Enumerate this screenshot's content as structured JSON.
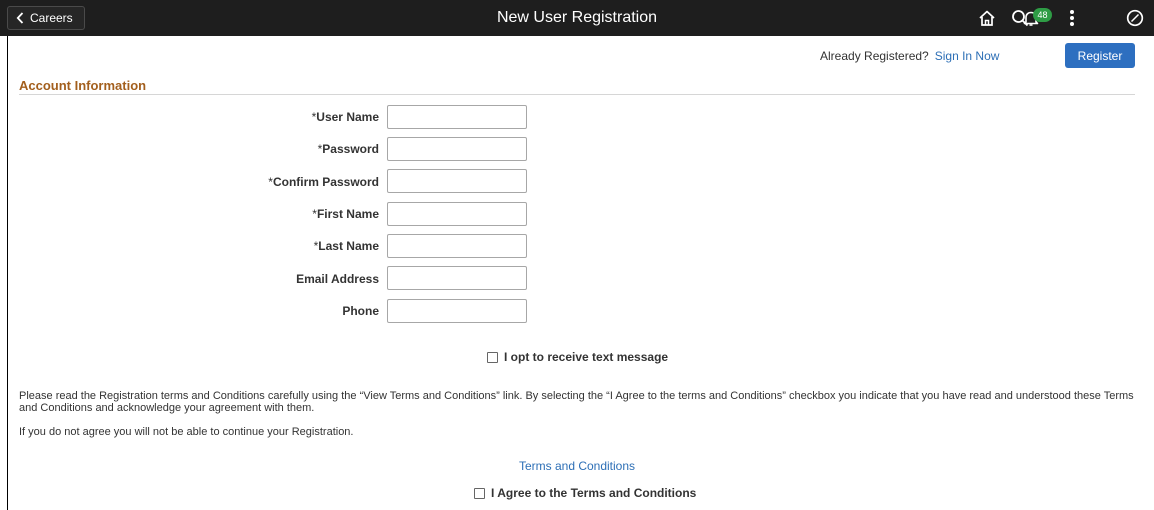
{
  "header": {
    "back_label": "Careers",
    "title": "New User Registration",
    "notification_count": "48",
    "icons": [
      "home-icon",
      "search-icon",
      "notification-bell-icon",
      "more-options-icon",
      "navbar-compass-icon"
    ]
  },
  "signin": {
    "prompt": "Already Registered?",
    "link": "Sign In Now",
    "register_label": "Register"
  },
  "section": {
    "title": "Account Information"
  },
  "fields": {
    "user_name": {
      "required": "*",
      "label": "User Name",
      "value": ""
    },
    "password": {
      "required": "*",
      "label": "Password",
      "value": ""
    },
    "confirm_password": {
      "required": "*",
      "label": "Confirm Password",
      "value": ""
    },
    "first_name": {
      "required": "*",
      "label": "First Name",
      "value": ""
    },
    "last_name": {
      "required": "*",
      "label": "Last Name",
      "value": ""
    },
    "email": {
      "required": "",
      "label": "Email Address",
      "value": ""
    },
    "phone": {
      "required": "",
      "label": "Phone",
      "value": ""
    }
  },
  "text_opt_in": {
    "label": "I opt to receive text message",
    "checked": false
  },
  "terms": {
    "paragraph1": "Please read the Registration terms and Conditions carefully using the “View Terms and Conditions” link. By selecting the “I Agree to the terms and Conditions” checkbox you indicate that you have read and understood these Terms and Conditions and acknowledge your agreement with them.",
    "paragraph2": "If you do not agree you will not be able to continue your Registration.",
    "link": "Terms and Conditions",
    "agree_label": "I Agree to the Terms and Conditions",
    "agree_checked": false
  },
  "colors": {
    "header_bg": "#1e1e1e",
    "accent_blue": "#2d6fc0",
    "section_title": "#a35f1d",
    "badge_green": "#2e9c45"
  }
}
